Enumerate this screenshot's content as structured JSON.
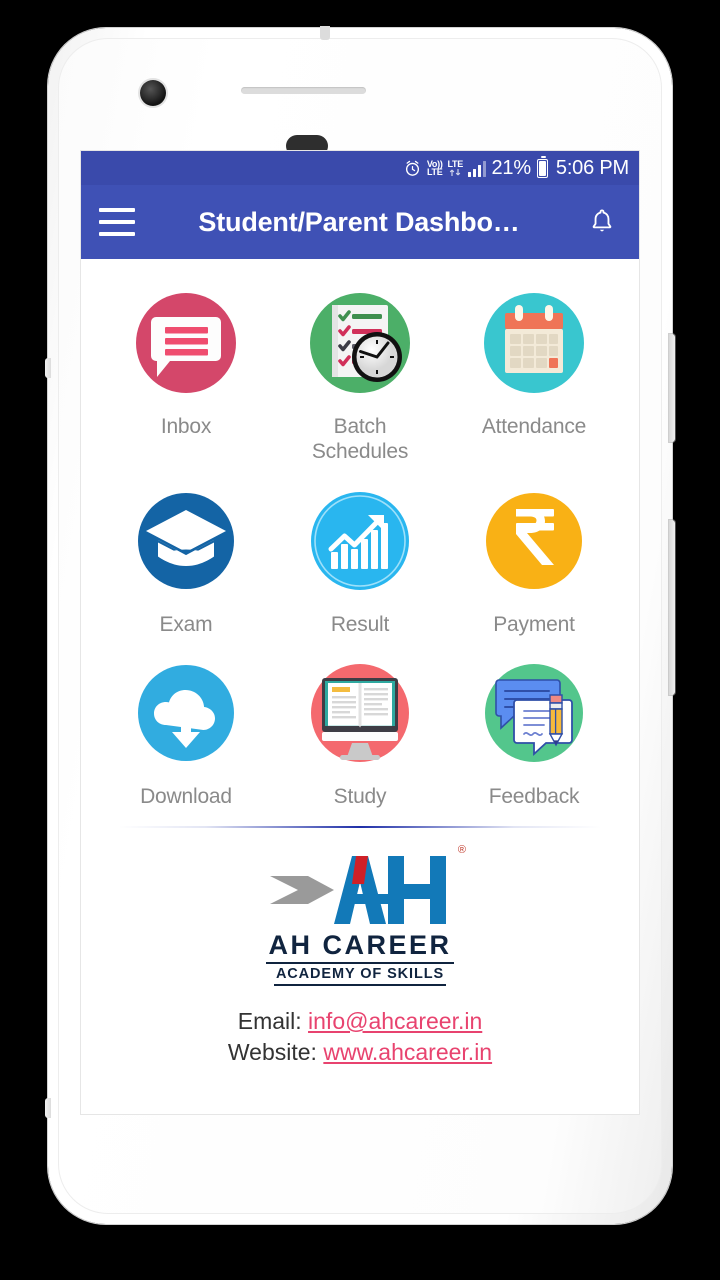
{
  "status_bar": {
    "alarm_icon": "alarm-clock-icon",
    "volte_line1": "Vo))",
    "volte_line2": "LTE",
    "lte_label": "LTE",
    "signal_icon": "signal-bars-icon",
    "battery_percent": "21%",
    "battery_icon": "battery-icon",
    "clock": "5:06 PM"
  },
  "app_bar": {
    "menu_icon": "hamburger-menu-icon",
    "title": "Student/Parent Dashbo…",
    "bell_icon": "notification-bell-icon",
    "background_color": "#3f51b5"
  },
  "dashboard": {
    "tiles": [
      {
        "id": "inbox",
        "label": "Inbox",
        "icon": "chat-message-icon",
        "circle_color": "#d4476a"
      },
      {
        "id": "batch-schedules",
        "label": "Batch\nSchedules",
        "icon": "checklist-clock-icon",
        "circle_color": "#4caf68"
      },
      {
        "id": "attendance",
        "label": "Attendance",
        "icon": "calendar-icon",
        "circle_color": "#39c6cf"
      },
      {
        "id": "exam",
        "label": "Exam",
        "icon": "graduation-cap-icon",
        "circle_color": "#1464a5"
      },
      {
        "id": "result",
        "label": "Result",
        "icon": "bar-chart-arrow-icon",
        "circle_color": "#29b6ef"
      },
      {
        "id": "payment",
        "label": "Payment",
        "icon": "rupee-icon",
        "circle_color": "#f9b115"
      },
      {
        "id": "download",
        "label": "Download",
        "icon": "cloud-download-icon",
        "circle_color": "#31ace0"
      },
      {
        "id": "study",
        "label": "Study",
        "icon": "monitor-book-icon",
        "circle_color": "#f4696e"
      },
      {
        "id": "feedback",
        "label": "Feedback",
        "icon": "chat-pencil-icon",
        "circle_color": "#53c68c"
      }
    ]
  },
  "footer": {
    "logo_wordmark": "AH  CAREER",
    "logo_tagline": "ACADEMY OF SKILLS",
    "registered_mark": "®",
    "email_label": "Email:",
    "email_value": "info@ahcareer.in",
    "website_label": "Website:",
    "website_value": "www.ahcareer.in",
    "link_color": "#e8436f"
  }
}
